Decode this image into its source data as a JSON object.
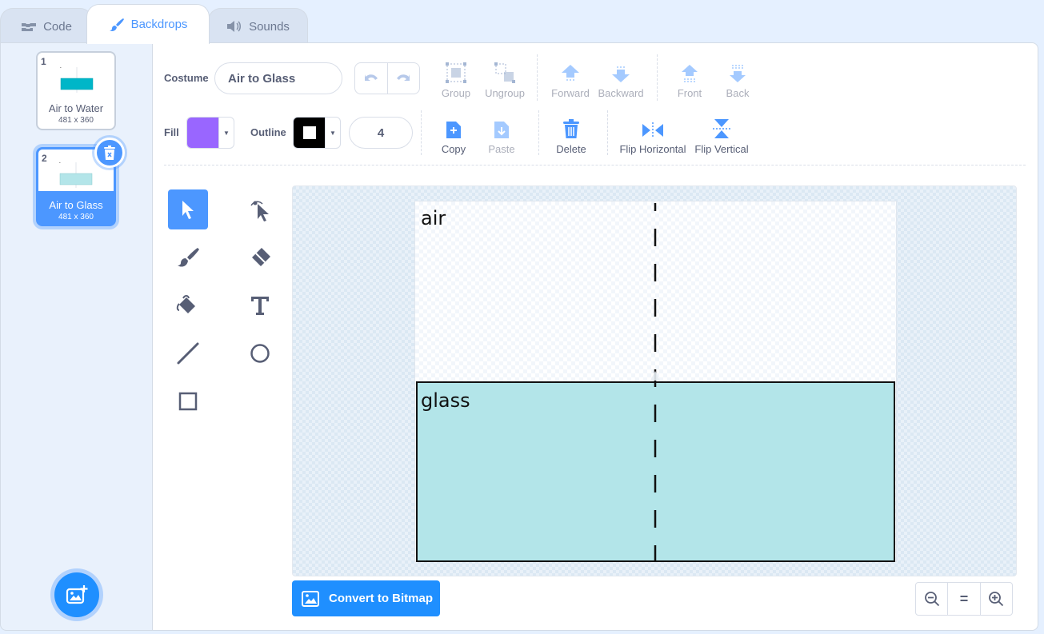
{
  "tabs": {
    "code": "Code",
    "backdrops": "Backdrops",
    "sounds": "Sounds"
  },
  "costumes": [
    {
      "number": "1",
      "name": "Air to Water",
      "size": "481 x 360",
      "fill_color": "#00b6c8"
    },
    {
      "number": "2",
      "name": "Air to Glass",
      "size": "481 x 360",
      "fill_color": "#b3e5e9"
    }
  ],
  "toolbar": {
    "costume_label": "Costume",
    "costume_name": "Air to Glass",
    "group": "Group",
    "ungroup": "Ungroup",
    "forward": "Forward",
    "backward": "Backward",
    "front": "Front",
    "back": "Back",
    "fill_label": "Fill",
    "outline_label": "Outline",
    "stroke_width": "4",
    "copy": "Copy",
    "paste": "Paste",
    "delete": "Delete",
    "flip_horizontal": "Flip Horizontal",
    "flip_vertical": "Flip Vertical"
  },
  "colors": {
    "accent": "#4c97ff",
    "fill": "#9966ff",
    "outline": "#000000",
    "glass": "#b3e5e9"
  },
  "canvas": {
    "top_label": "air",
    "bottom_label": "glass"
  },
  "bottom": {
    "convert_button": "Convert to Bitmap",
    "zoom_reset": "="
  }
}
